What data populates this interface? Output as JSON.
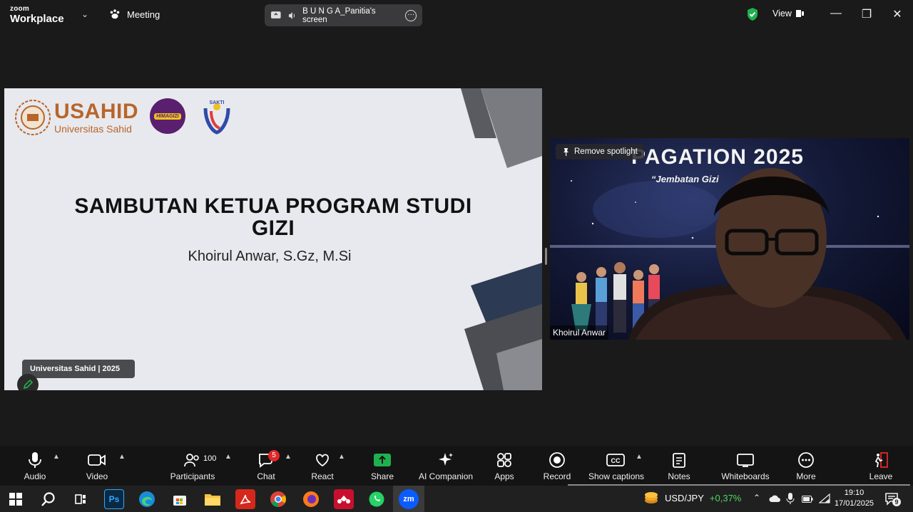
{
  "app": {
    "brand_top": "zoom",
    "brand_bottom": "Workplace",
    "meeting_label": "Meeting"
  },
  "share_pill": {
    "label": "B U N G A_Panitia's screen"
  },
  "header": {
    "view_label": "View"
  },
  "slide": {
    "logo_text": "USAHID",
    "logo_subtext": "Universitas Sahid",
    "logo2_text": "HIMAGIZI",
    "logo3_text": "SAKTI",
    "title_line1": "SAMBUTAN KETUA PROGRAM STUDI",
    "title_line2": "GIZI",
    "speaker": "Khoirul Anwar, S.Gz, M.Si",
    "footer": "Universitas Sahid |  2025"
  },
  "video": {
    "spotlight_label": "Remove spotlight",
    "banner_title": "PAGATION 2025",
    "banner_subtitle": "“Jembatan Gizi",
    "participant_name": "Khoirul Anwar"
  },
  "toolbar": {
    "audio": "Audio",
    "video": "Video",
    "participants": "Participants",
    "participants_count": "100",
    "chat": "Chat",
    "chat_badge": "5",
    "react": "React",
    "share": "Share",
    "ai_companion": "AI Companion",
    "apps": "Apps",
    "record": "Record",
    "show_captions": "Show captions",
    "notes": "Notes",
    "whiteboards": "Whiteboards",
    "more": "More",
    "leave": "Leave"
  },
  "taskbar": {
    "ticker_symbol": "USD/JPY",
    "ticker_change": "+0,37%",
    "time": "19:10",
    "date": "17/01/2025",
    "notification_count": "9",
    "zoom_app_label": "zm",
    "ps_label": "Ps"
  },
  "colors": {
    "accent_green": "#1fb14f",
    "brand_orange": "#b8652a",
    "badge_red": "#e02828",
    "leave_red": "#e02828"
  }
}
